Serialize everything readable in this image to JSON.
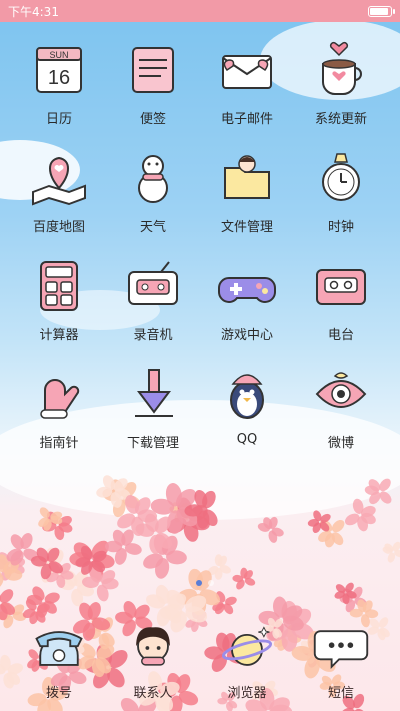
{
  "status_bar": {
    "time": "下午4:31",
    "battery_level": 0.95
  },
  "apps": [
    {
      "id": "calendar",
      "label": "日历",
      "icon": "calendar-icon",
      "calendar_day": "SUN",
      "calendar_date": "16"
    },
    {
      "id": "notes",
      "label": "便签",
      "icon": "notepad-icon"
    },
    {
      "id": "email",
      "label": "电子邮件",
      "icon": "envelope-icon"
    },
    {
      "id": "system-update",
      "label": "系统更新",
      "icon": "coffee-cup-icon"
    },
    {
      "id": "baidu-map",
      "label": "百度地图",
      "icon": "map-pin-icon"
    },
    {
      "id": "weather",
      "label": "天气",
      "icon": "snowman-icon"
    },
    {
      "id": "file-manager",
      "label": "文件管理",
      "icon": "folder-icon"
    },
    {
      "id": "clock",
      "label": "时钟",
      "icon": "alarm-clock-icon"
    },
    {
      "id": "calculator",
      "label": "计算器",
      "icon": "calculator-icon"
    },
    {
      "id": "recorder",
      "label": "录音机",
      "icon": "radio-icon"
    },
    {
      "id": "game-center",
      "label": "游戏中心",
      "icon": "gamepad-icon"
    },
    {
      "id": "radio",
      "label": "电台",
      "icon": "cassette-icon"
    },
    {
      "id": "compass",
      "label": "指南针",
      "icon": "mitten-icon"
    },
    {
      "id": "download-manager",
      "label": "下载管理",
      "icon": "download-arrow-icon"
    },
    {
      "id": "qq",
      "label": "QQ",
      "icon": "penguin-icon"
    },
    {
      "id": "weibo",
      "label": "微博",
      "icon": "eye-icon"
    }
  ],
  "dock": [
    {
      "id": "dialer",
      "label": "拨号",
      "icon": "telephone-icon"
    },
    {
      "id": "contacts",
      "label": "联系人",
      "icon": "girl-avatar-icon"
    },
    {
      "id": "browser",
      "label": "浏览器",
      "icon": "planet-icon"
    },
    {
      "id": "messages",
      "label": "短信",
      "icon": "speech-bubble-icon"
    }
  ],
  "colors": {
    "status_bar": "#f29aa7",
    "accent_pink": "#f6a5b5",
    "sky": "#7cc3ef"
  }
}
